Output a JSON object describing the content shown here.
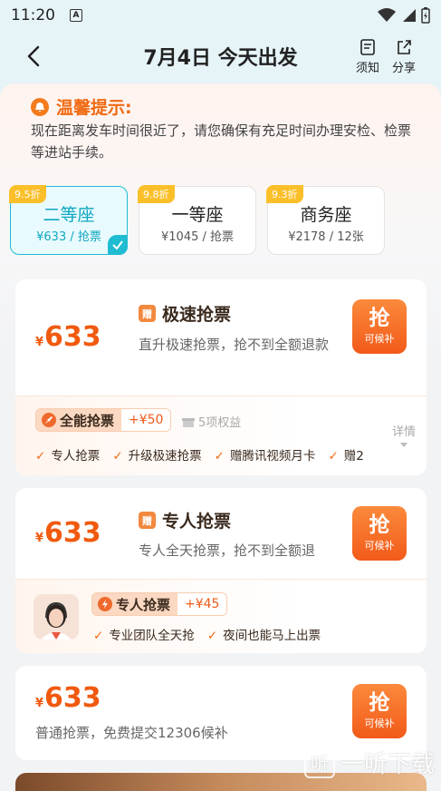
{
  "status": {
    "time": "11:20",
    "notif_letter": "A"
  },
  "header": {
    "title": "7月4日 今天出发",
    "notice_label": "须知",
    "share_label": "分享"
  },
  "tip": {
    "title": "温馨提示:",
    "text": "现在距离发车时间很近了，请您确保有充足时间办理安检、检票等进站手续。"
  },
  "seats": [
    {
      "discount": "9.5折",
      "name": "二等座",
      "sub": "¥633 / 抢票",
      "selected": true
    },
    {
      "discount": "9.8折",
      "name": "一等座",
      "sub": "¥1045 / 抢票",
      "selected": false
    },
    {
      "discount": "9.3折",
      "name": "商务座",
      "sub": "¥2178 / 12张",
      "selected": false
    }
  ],
  "cards": [
    {
      "currency": "¥",
      "price": "633",
      "gift": "赠",
      "title": "极速抢票",
      "desc": "直升极速抢票，抢不到全额退款",
      "grab": "抢",
      "grab_sub": "可候补",
      "tag_name": "全能抢票",
      "tag_price": "+¥50",
      "rights": "5项权益",
      "detail": "详情",
      "features": [
        "专人抢票",
        "升级极速抢票",
        "赠腾讯视频月卡",
        "赠2"
      ]
    },
    {
      "currency": "¥",
      "price": "633",
      "gift": "赠",
      "title": "专人抢票",
      "desc": "专人全天抢票，抢不到全额退",
      "grab": "抢",
      "grab_sub": "可候补",
      "tag_name": "专人抢票",
      "tag_price": "+¥45",
      "features": [
        "专业团队全天抢",
        "夜间也能马上出票"
      ]
    },
    {
      "currency": "¥",
      "price": "633",
      "desc": "普通抢票，免费提交12306候补",
      "grab": "抢",
      "grab_sub": "可候补"
    }
  ],
  "watermark": {
    "text": "一听下载",
    "glyph": "听"
  },
  "colors": {
    "accent": "#f05a0f",
    "teal": "#1fbcd2",
    "background": "#f2f3f5"
  }
}
